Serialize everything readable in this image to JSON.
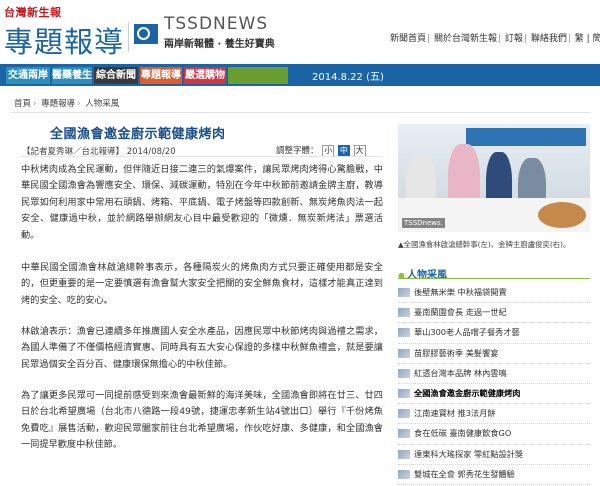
{
  "header": {
    "logo_small": "台灣新生報",
    "logo_big": "專題報導",
    "brand_title": "TSSDNEWS",
    "brand_sub": "兩岸新報體 · 養生好寶典",
    "links": [
      "新聞首頁",
      "關於台灣新生報",
      "訂報",
      "聯絡我們",
      "繁 | 簡"
    ]
  },
  "nav": {
    "tabs": [
      "交通兩岸",
      "醫藥養生",
      "綜合新聞",
      "專題報導",
      "嚴選購物"
    ],
    "active_tab": "專題報導",
    "date": "2014.8.22 (五)"
  },
  "breadcrumb": [
    "首頁",
    "專題報導",
    "人物采風"
  ],
  "article": {
    "title": "全國漁會邀金廚示範健康烤肉",
    "byline": "【記者夏秀琳／台北報導】 2014/08/20",
    "font_label": "調整字體：",
    "font_sizes": [
      "小",
      "中",
      "大"
    ],
    "active_font": "中",
    "paragraphs": [
      "中秋烤肉成為全民運動，但伴隨近日接二連三的氣爆案件，讓民眾烤肉烤得心驚膽戰，中華民國全國漁會為響應安全、環保、減碳運動，特別在今年中秋節前邀請金牌主廚，教導民眾如何利用家中常用石頭鍋、烤箱、平底鍋、電子烤盤等四款創新、無炭烤魚肉法一起安全、健康過中秋，並於網路舉辦網友心目中最受歡迎的「微燻．無炭新烤法」票選活動。",
      "中華民國全國漁會林啟滄總幹事表示，各種隔炭火的烤魚肉方式只要正確使用都是安全的，但更重要的是一定要慎選有漁會幫大家安全把關的安全鮮魚食材，這樣才能真正達到烤的安全、吃的安心。",
      "林啟滄表示：漁會已連續多年推廣國人安全水產品，因應民眾中秋節烤肉與過禮之需求，為國人準備了不僅價格經濟實惠、同時具有五大安心保證的多樣中秋鮮魚禮盒，就是要讓民眾過個安全百分百、健康環保無擔心的中秋佳節。",
      "為了讓更多民眾可一同提前感受到來漁會最新鮮的海洋美味，全國漁會即將在廿三、廿四日於台北希望廣場（台北市八德路一段49號，捷運忠孝新生站4號出口）舉行『千份烤魚免費吃』展售活動，歡迎民眾闔家前往台北希望廣場，作伙吃好康、多健康，和全國漁會一同提早歡度中秋佳節。"
    ]
  },
  "photo": {
    "tag": "TSSDnews.",
    "caption": "▲全國漁會林啟滄總幹事(左)、金牌主廚盧俊奕(右)。"
  },
  "sidebar": {
    "heading": "人物采風",
    "items": [
      "後壁無米樂 中秋福袋開賣",
      "臺南蘭園會長 走過一世紀",
      "華山300老人品嚐子餐秀才藝",
      "苗膠膠藝術季 美髮饗宴",
      "紅透台灣本品牌 林內雲鳴",
      "全國漁會邀金廚示範健康烤肉",
      "江南速寶材 推3法月餅",
      "食在低碳 臺南健康飲食GO",
      "達東科大瑤探家 零紅點設計獎",
      "雙城在全會 郭秀花生發體驗"
    ],
    "highlight_index": 5
  },
  "colors": {
    "brand_blue": "#1b65a7",
    "logo_red": "#c4161c",
    "active_tab": "#e35a2b",
    "accent_green": "#8cbf3f"
  }
}
